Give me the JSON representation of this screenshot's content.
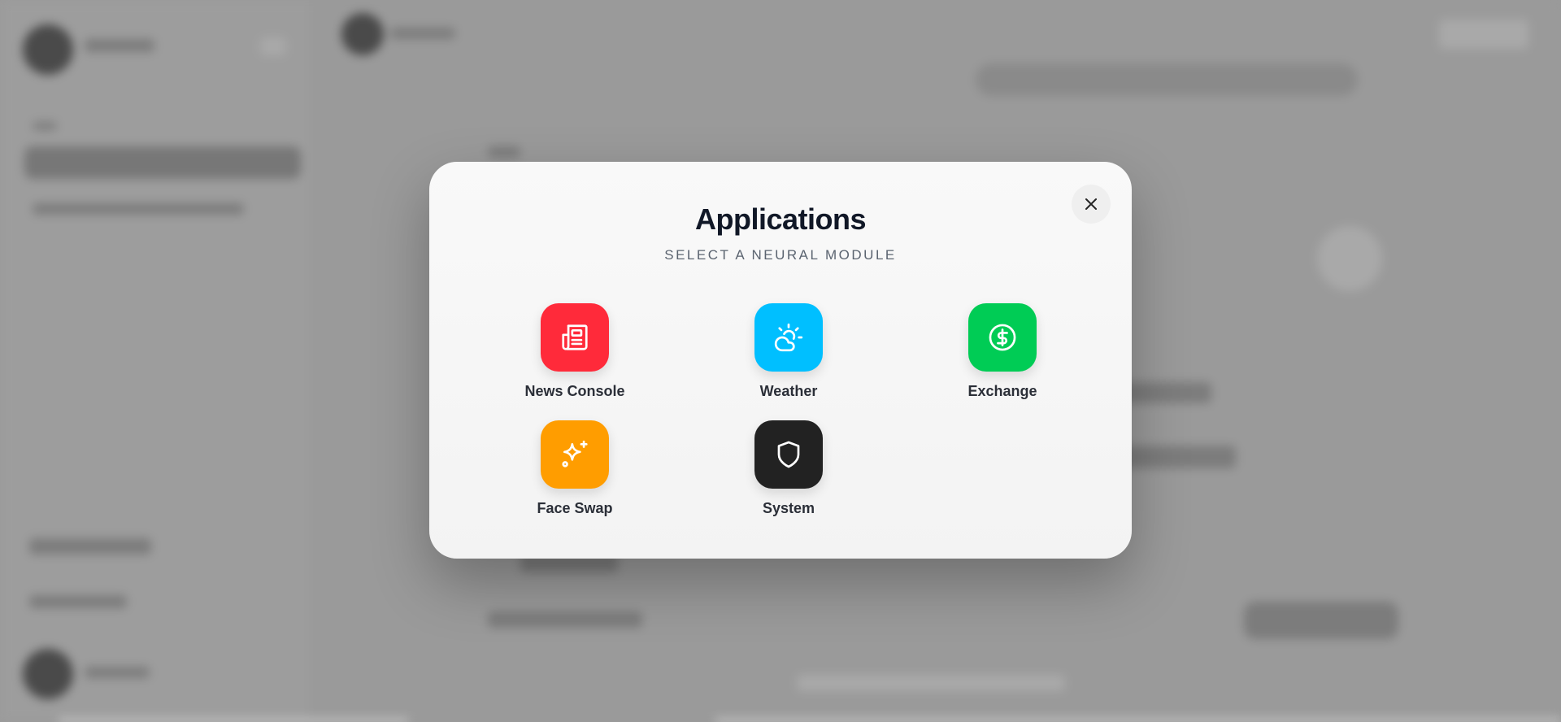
{
  "modal": {
    "title": "Applications",
    "subtitle": "SELECT A NEURAL MODULE",
    "close_icon": "close-icon",
    "apps": [
      {
        "label": "News Console",
        "icon": "newspaper-icon",
        "color": "#ff2a3a"
      },
      {
        "label": "Weather",
        "icon": "cloud-sun-icon",
        "color": "#00bfff"
      },
      {
        "label": "Exchange",
        "icon": "dollar-circle-icon",
        "color": "#00cc55"
      },
      {
        "label": "Face Swap",
        "icon": "sparkles-icon",
        "color": "#ff9d00"
      },
      {
        "label": "System",
        "icon": "shield-icon",
        "color": "#222222"
      }
    ]
  },
  "colors": {
    "overlay": "#9a9a9a",
    "modal_bg": "#f6f6f6",
    "title": "#111827",
    "subtitle": "#5b6470"
  }
}
